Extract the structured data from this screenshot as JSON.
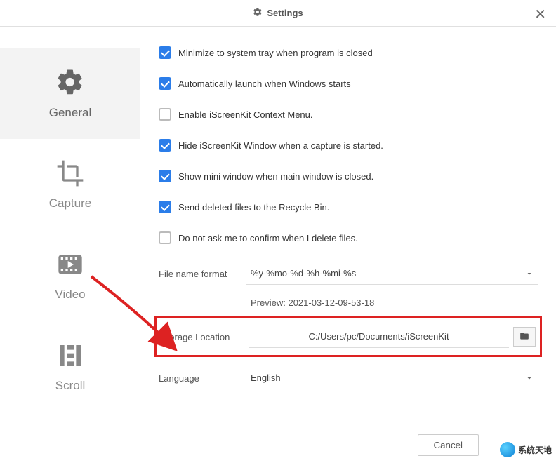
{
  "title": "Settings",
  "sidebar": [
    {
      "label": "General"
    },
    {
      "label": "Capture"
    },
    {
      "label": "Video"
    },
    {
      "label": "Scroll"
    }
  ],
  "checks": [
    {
      "label": "Minimize to system tray when program is closed",
      "checked": true
    },
    {
      "label": "Automatically launch when Windows starts",
      "checked": true
    },
    {
      "label": "Enable iScreenKit Context Menu.",
      "checked": false
    },
    {
      "label": "Hide iScreenKit Window when a capture is started.",
      "checked": true
    },
    {
      "label": "Show mini window when main window is closed.",
      "checked": true
    },
    {
      "label": "Send deleted files to the Recycle Bin.",
      "checked": true
    },
    {
      "label": "Do not ask me to confirm when I delete files.",
      "checked": false
    }
  ],
  "file_format": {
    "label": "File name format",
    "value": "%y-%mo-%d-%h-%mi-%s"
  },
  "preview": "Preview: 2021-03-12-09-53-18",
  "storage": {
    "label": "Storage Location",
    "value": "C:/Users/pc/Documents/iScreenKit"
  },
  "language": {
    "label": "Language",
    "value": "English"
  },
  "cancel": "Cancel",
  "watermark": "系统天地",
  "colors": {
    "accent": "#2b7de9",
    "highlight": "#d22"
  }
}
